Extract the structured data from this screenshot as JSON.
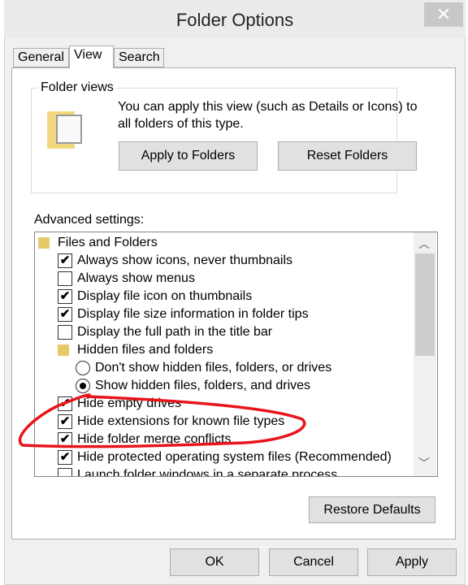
{
  "window": {
    "title": "Folder Options",
    "close": "✕"
  },
  "tabs": [
    {
      "label": "General"
    },
    {
      "label": "View",
      "active": true
    },
    {
      "label": "Search"
    }
  ],
  "folder_views": {
    "legend": "Folder views",
    "description": "You can apply this view (such as Details or Icons) to all folders of this type.",
    "apply_label": "Apply to Folders",
    "reset_label": "Reset Folders"
  },
  "advanced": {
    "label": "Advanced settings:",
    "items": [
      {
        "type": "folder",
        "label": "Files and Folders",
        "level": 0
      },
      {
        "type": "checkbox",
        "label": "Always show icons, never thumbnails",
        "checked": true,
        "level": 1
      },
      {
        "type": "checkbox",
        "label": "Always show menus",
        "checked": false,
        "level": 1
      },
      {
        "type": "checkbox",
        "label": "Display file icon on thumbnails",
        "checked": true,
        "level": 1
      },
      {
        "type": "checkbox",
        "label": "Display file size information in folder tips",
        "checked": true,
        "level": 1
      },
      {
        "type": "checkbox",
        "label": "Display the full path in the title bar",
        "checked": false,
        "level": 1
      },
      {
        "type": "folder",
        "label": "Hidden files and folders",
        "level": 1
      },
      {
        "type": "radio",
        "label": "Don't show hidden files, folders, or drives",
        "checked": false,
        "level": 2
      },
      {
        "type": "radio",
        "label": "Show hidden files, folders, and drives",
        "checked": true,
        "level": 2
      },
      {
        "type": "checkbox",
        "label": "Hide empty drives",
        "checked": true,
        "level": 1
      },
      {
        "type": "checkbox",
        "label": "Hide extensions for known file types",
        "checked": true,
        "level": 1
      },
      {
        "type": "checkbox",
        "label": "Hide folder merge conflicts",
        "checked": true,
        "level": 1
      },
      {
        "type": "checkbox",
        "label": "Hide protected operating system files (Recommended)",
        "checked": true,
        "level": 1
      },
      {
        "type": "checkbox",
        "label": "Launch folder windows in a separate process",
        "checked": false,
        "level": 1
      }
    ],
    "restore_label": "Restore Defaults"
  },
  "footer": {
    "ok": "OK",
    "cancel": "Cancel",
    "apply": "Apply"
  },
  "annotation": {
    "color": "#e8141b"
  }
}
